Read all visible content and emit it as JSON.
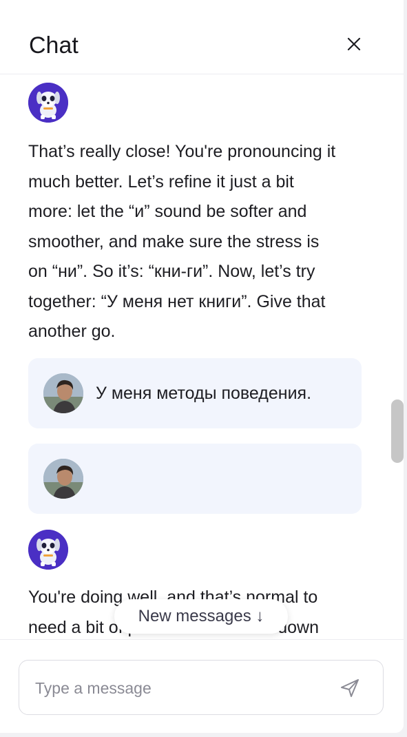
{
  "header": {
    "title": "Chat"
  },
  "messages": [
    {
      "role": "assistant",
      "lines": [
        "That’s really close! You're pronouncing it",
        "much better. Let’s refine it just a bit",
        "more: let the “и” sound be softer and",
        "smoother, and make sure the stress is",
        "on “ни”. So it’s: “кни-ги”. Now, let’s try",
        "together: “У меня нет книги”. Give that",
        "another go."
      ]
    },
    {
      "role": "user",
      "text": "У меня методы поведения."
    },
    {
      "role": "user",
      "text": ""
    },
    {
      "role": "assistant",
      "lines": [
        "You're doing well, and that’s normal to",
        "need a bit of practice. Let’s slow down"
      ]
    }
  ],
  "new_messages_button": {
    "label": "New messages ↓"
  },
  "composer": {
    "placeholder": "Type a message",
    "value": ""
  },
  "icons": {
    "close": "close-icon",
    "send": "send-icon"
  },
  "colors": {
    "bot_avatar_bg": "#4a2fc4",
    "user_bubble_bg": "#f2f5fd"
  }
}
